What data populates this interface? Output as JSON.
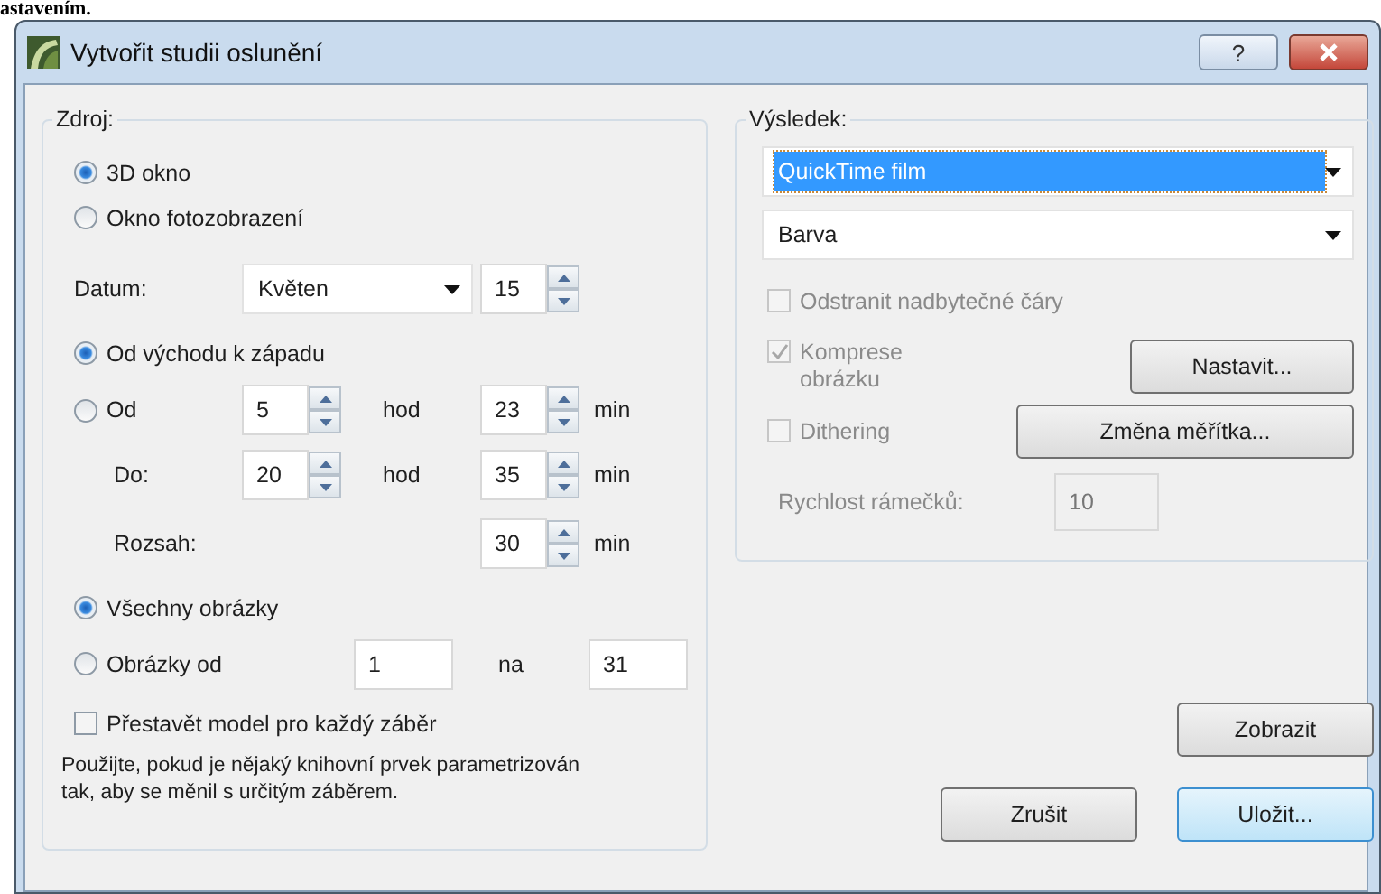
{
  "caption_fragment": "astavením.",
  "window": {
    "title": "Vytvořit studii oslunění",
    "help_button": "?"
  },
  "source": {
    "label": "Zdroj:",
    "view_options": [
      {
        "label": "3D okno",
        "selected": true
      },
      {
        "label": "Okno fotozobrazení",
        "selected": false
      }
    ],
    "date": {
      "label": "Datum:",
      "month": "Květen",
      "day": "15"
    },
    "range_options": [
      {
        "label": "Od východu k západu",
        "selected": true
      },
      {
        "label": "Od",
        "selected": false
      }
    ],
    "from": {
      "hour": "5",
      "hour_unit": "hod",
      "minute": "23",
      "minute_unit": "min"
    },
    "to": {
      "label": "Do:",
      "hour": "20",
      "hour_unit": "hod",
      "minute": "35",
      "minute_unit": "min"
    },
    "span": {
      "label": "Rozsah:",
      "value": "30",
      "unit": "min"
    },
    "frame_options": [
      {
        "label": "Všechny obrázky",
        "selected": true
      },
      {
        "label": "Obrázky od",
        "selected": false
      }
    ],
    "frame_from": "1",
    "frame_joiner": "na",
    "frame_to": "31",
    "rebuild": {
      "label": "Přestavět model pro každý záběr",
      "checked": false
    },
    "note": "Použijte, pokud je nějaký knihovní prvek parametrizován tak, aby se měnil s určitým záběrem."
  },
  "result": {
    "label": "Výsledek:",
    "format": "QuickTime film",
    "color_mode": "Barva",
    "options": [
      {
        "label": "Odstranit nadbytečné čáry",
        "checked": false,
        "disabled": true
      },
      {
        "label": "Komprese obrázku",
        "checked": true,
        "disabled": true,
        "button": "Nastavit..."
      },
      {
        "label": "Dithering",
        "checked": false,
        "disabled": true,
        "button": "Změna měřítka..."
      }
    ],
    "frame_rate": {
      "label": "Rychlost rámečků:",
      "value": "10",
      "disabled": true
    }
  },
  "preview_button": "Zobrazit",
  "buttons": [
    {
      "label": "Zrušit",
      "default": false
    },
    {
      "label": "Uložit...",
      "default": true
    }
  ]
}
